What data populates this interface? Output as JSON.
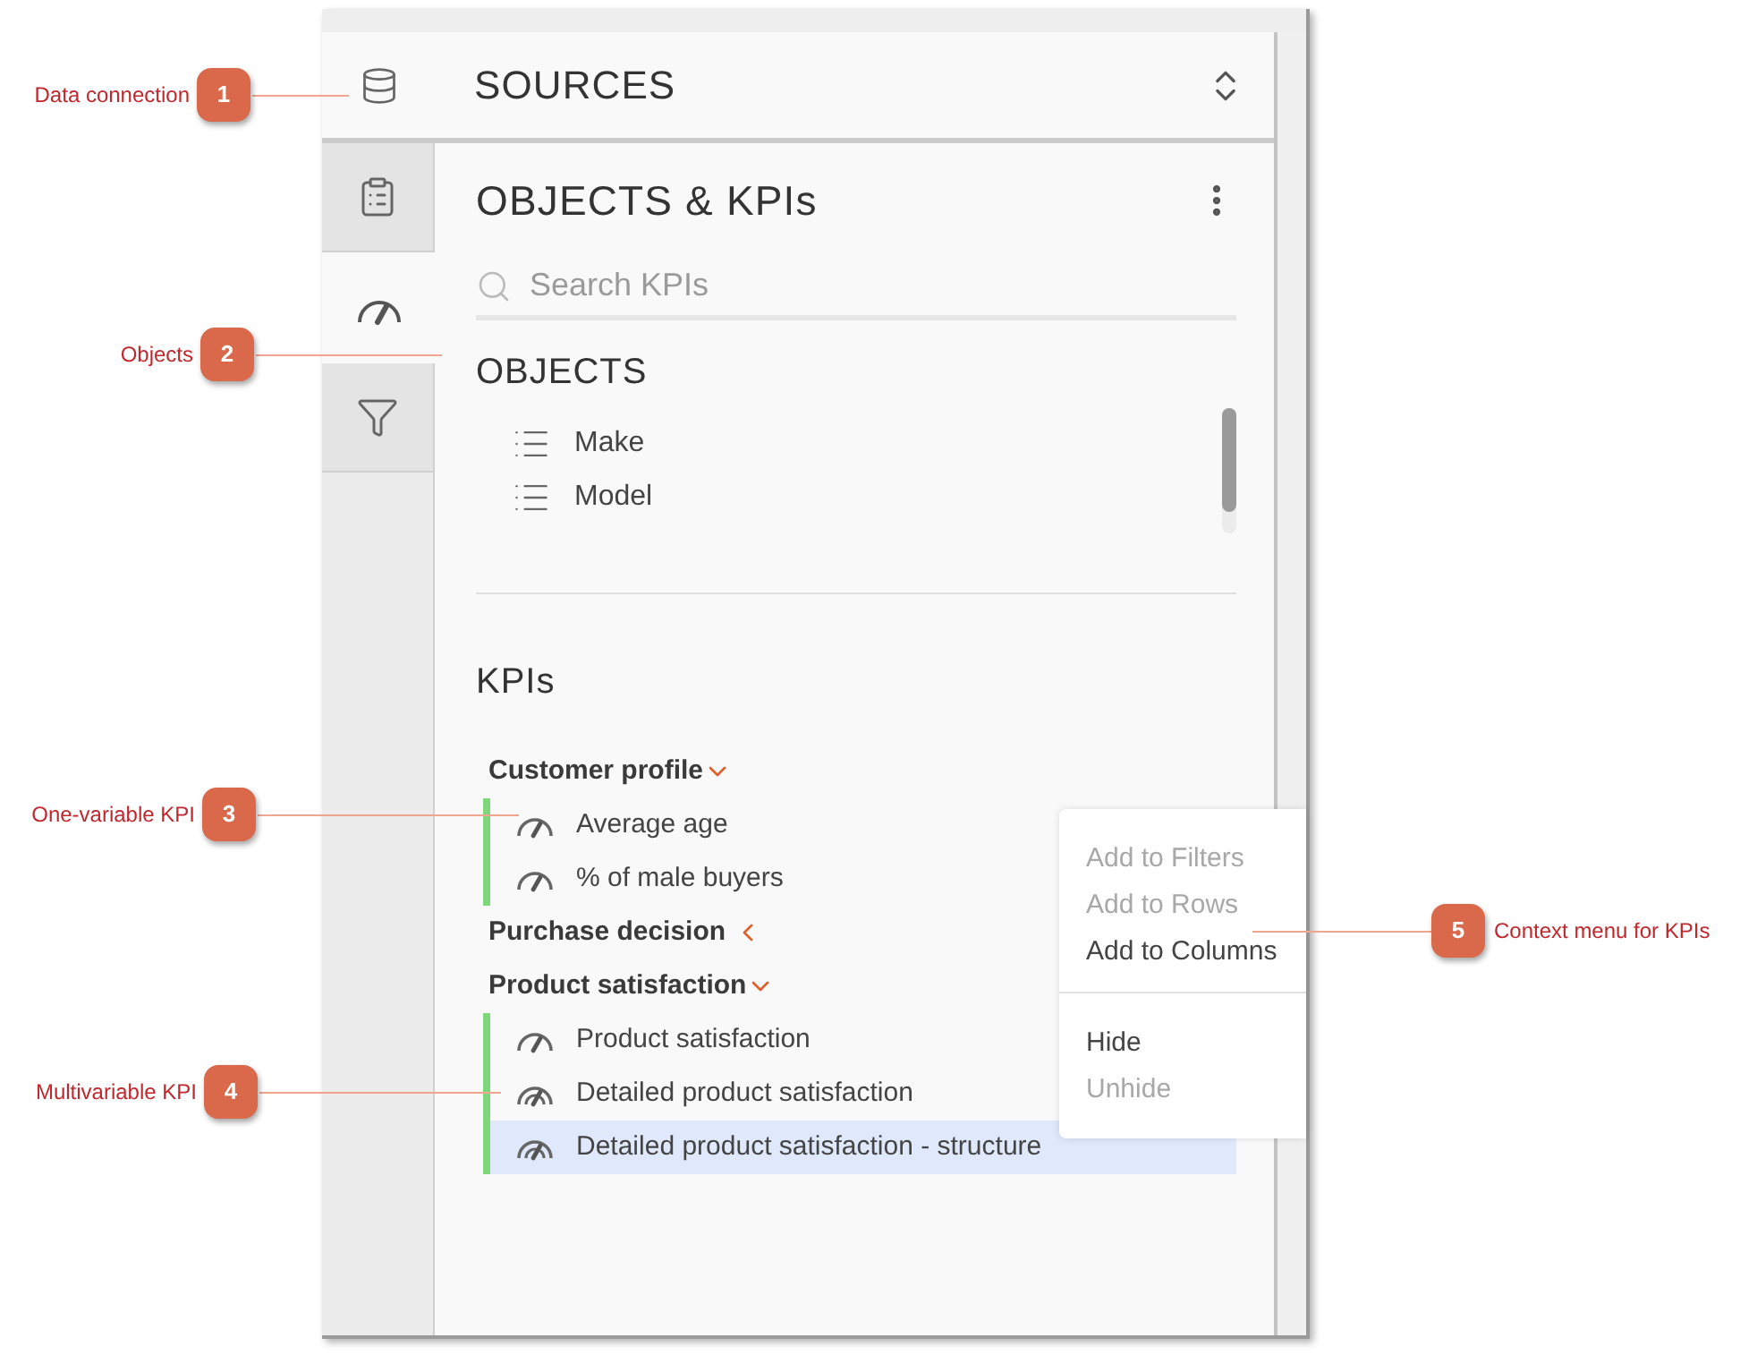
{
  "sources": {
    "title": "SOURCES"
  },
  "tabs": [
    {
      "kind": "clipboard",
      "selected": false
    },
    {
      "kind": "gauge",
      "selected": true
    },
    {
      "kind": "filter",
      "selected": false
    }
  ],
  "panel": {
    "title": "OBJECTS & KPIs",
    "search": {
      "placeholder": "Search KPIs"
    }
  },
  "objects": {
    "title": "OBJECTS",
    "items": [
      "Make",
      "Model"
    ]
  },
  "kpis": {
    "title": "KPIs",
    "groups": [
      {
        "label": "Customer profile",
        "expanded": true,
        "items": [
          {
            "label": "Average age",
            "kind": "single",
            "selected": false
          },
          {
            "label": "% of male buyers",
            "kind": "single",
            "selected": false
          }
        ]
      },
      {
        "label": "Purchase decision",
        "expanded": false
      },
      {
        "label": "Product satisfaction",
        "expanded": true,
        "items": [
          {
            "label": "Product satisfaction",
            "kind": "single",
            "selected": false
          },
          {
            "label": "Detailed product satisfaction",
            "kind": "multi",
            "selected": false
          },
          {
            "label": "Detailed product satisfaction - structure",
            "kind": "multi",
            "selected": true
          }
        ]
      }
    ]
  },
  "context_menu": {
    "sections": [
      [
        {
          "label": "Add to Filters",
          "disabled": true
        },
        {
          "label": "Add to Rows",
          "disabled": true
        },
        {
          "label": "Add to Columns",
          "disabled": false
        }
      ],
      [
        {
          "label": "Hide",
          "disabled": false
        },
        {
          "label": "Unhide",
          "disabled": true
        }
      ]
    ]
  },
  "callouts": [
    {
      "number": "1",
      "label": "Data connection"
    },
    {
      "number": "2",
      "label": "Objects"
    },
    {
      "number": "3",
      "label": "One-variable KPI"
    },
    {
      "number": "4",
      "label": "Multivariable KPI"
    },
    {
      "number": "5",
      "label": "Context menu for KPIs"
    }
  ]
}
